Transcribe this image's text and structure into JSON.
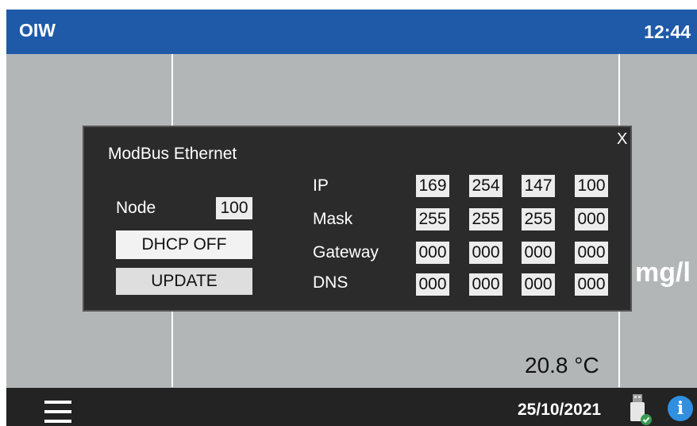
{
  "header": {
    "title": "OIW",
    "time": "12:44"
  },
  "display": {
    "unit": "mg/l",
    "temperature": "20.8 °C"
  },
  "footer": {
    "date": "25/10/2021",
    "menu_icon": "hamburger-icon",
    "usb_icon": "usb-drive-icon",
    "info_icon": "info-icon",
    "info_glyph": "i"
  },
  "dialog": {
    "title": "ModBus Ethernet",
    "close": "X",
    "node_label": "Node",
    "node_value": "100",
    "dhcp_button": "DHCP OFF",
    "update_button": "UPDATE",
    "ip_label": "IP",
    "ip": [
      "169",
      "254",
      "147",
      "100"
    ],
    "mask_label": "Mask",
    "mask": [
      "255",
      "255",
      "255",
      "000"
    ],
    "gateway_label": "Gateway",
    "gateway": [
      "000",
      "000",
      "000",
      "000"
    ],
    "dns_label": "DNS",
    "dns": [
      "000",
      "000",
      "000",
      "000"
    ]
  },
  "colors": {
    "header": "#1e5aa8",
    "background": "#b3b6b7",
    "footer": "#232323",
    "dialog": "#2b2b2b",
    "info": "#2f8fe0"
  }
}
